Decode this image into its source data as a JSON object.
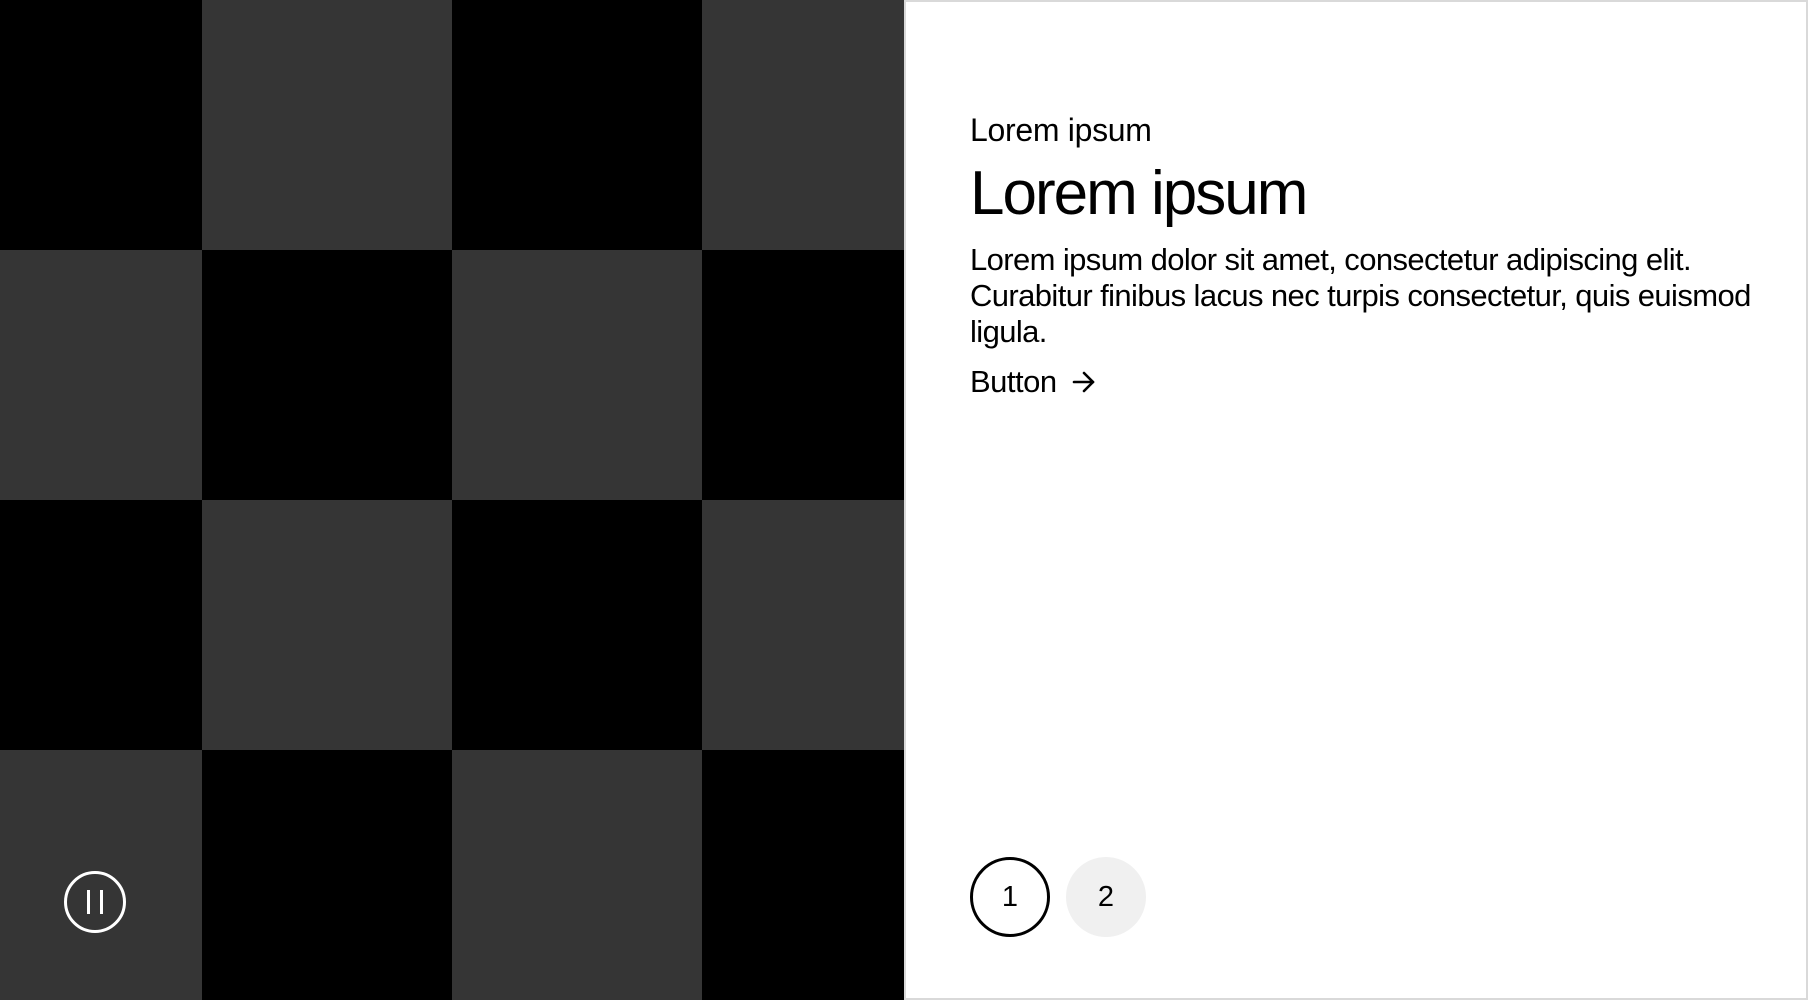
{
  "media": {
    "colors": {
      "dark": "#000000",
      "light": "#353535"
    },
    "pause_icon": "pause-icon"
  },
  "content": {
    "eyebrow": "Lorem ipsum",
    "heading": "Lorem ipsum",
    "body": "Lorem ipsum dolor sit amet, consectetur adipiscing elit. Curabitur finibus lacus nec turpis consectetur, quis euismod ligula.",
    "button_label": "Button",
    "button_icon": "arrow-right-icon"
  },
  "pagination": {
    "items": [
      {
        "label": "1",
        "active": true
      },
      {
        "label": "2",
        "active": false
      }
    ]
  }
}
